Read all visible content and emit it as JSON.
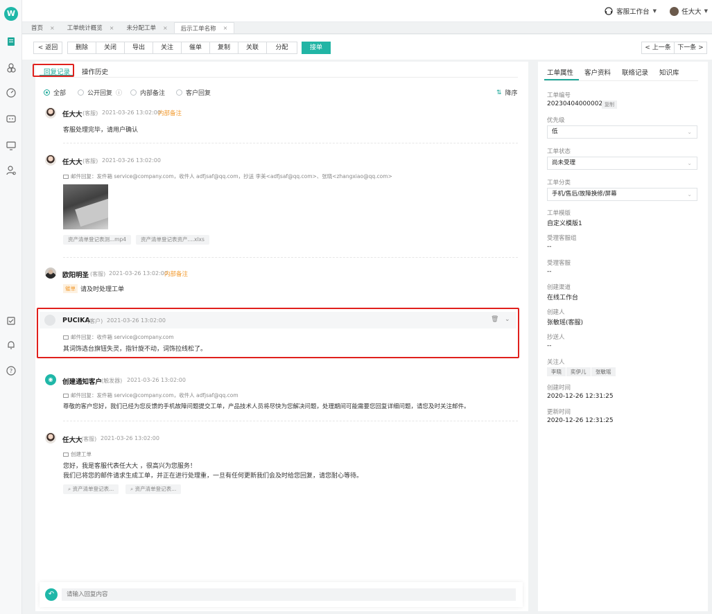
{
  "header": {
    "workspace_label": "客服工作台",
    "user_name": "任大大"
  },
  "page_tabs": [
    {
      "label": "首页"
    },
    {
      "label": "工单统计概览"
    },
    {
      "label": "未分配工单"
    },
    {
      "label": "后示工单名称"
    }
  ],
  "toolbar": {
    "back": "返回",
    "actions": [
      "删除",
      "关闭",
      "导出",
      "关注",
      "催单",
      "复制",
      "关联",
      "分配"
    ],
    "accept": "接单",
    "prev": "上一条",
    "next": "下一条"
  },
  "main_tabs": {
    "reply_records": "回复记录",
    "operation_history": "操作历史"
  },
  "filters": {
    "all": "全部",
    "public_reply": "公开回复",
    "internal_note": "内部备注",
    "customer_reply": "客户回复",
    "sort": "降序"
  },
  "records": [
    {
      "name": "任大大",
      "role": "(客服)",
      "time": "2021-03-26 13:02:00",
      "tag": "内部备注",
      "text": "客服处理完毕，请用户确认"
    },
    {
      "name": "任大大",
      "role": "(客服)",
      "time": "2021-03-26 13:02:00",
      "mail_line": "邮件回复：发件箱 service@company.com，收件人 adfjsaf@qq.com，抄送 李美<adfjsaf@qq.com>、张晓<zhangxiao@qq.com>",
      "attachments": [
        "资产清单登记表测...mp4",
        "资产清单登记表资产....xlxs"
      ]
    },
    {
      "name": "欧阳明圣",
      "role": "(客服)",
      "time": "2021-03-26 13:02:00",
      "tag": "内部备注",
      "badge": "催单",
      "text": "请及时处理工单"
    },
    {
      "name": "PUCIKA",
      "role": "(客户)",
      "time": "2021-03-26 13:02:00",
      "mail_line": "邮件回复：收件箱 service@company.com",
      "text": "其词饰选台旗钮失灵，指针旋不动，词饰拉线松了。"
    },
    {
      "name": "创建通知客户",
      "role": "(触发器)",
      "time": "2021-03-26 13:02:00",
      "mail_line": "邮件回复：发件箱 service@company.com，收件人 adfjsaf@qq.com",
      "text": "尊敬的客户您好，我们已经为您反馈的手机故障问题提交工单，产品技术人员将尽快为您解决问题，处理期间可能需要您回复详细问题，请您及时关注邮件。"
    },
    {
      "name": "任大大",
      "role": "(客服)",
      "time": "2021-03-26 13:02:00",
      "sub_label": "创建工单",
      "text_line1": "您好，我是客服代表任大大 ，很高兴为您服务！",
      "text_line2": "我们已将您的邮件请求生成工单，并正在进行处理重，一旦有任何更新我们会及时给您回复，请您耐心等待。",
      "attachments": [
        "资产清单登记表...",
        "资产清单登记表..."
      ]
    }
  ],
  "reply_placeholder": "请输入回复内容",
  "side_panel": {
    "tabs": [
      "工单属性",
      "客户资料",
      "联络记录",
      "知识库"
    ],
    "ticket_no_label": "工单编号",
    "ticket_no": "20230404000002",
    "copy": "复制",
    "priority_label": "优先级",
    "priority": "低",
    "status_label": "工单状态",
    "status": "尚未受理",
    "category_label": "工单分类",
    "category": "手机/售后/故障换修/屏幕",
    "template_label": "工单模版",
    "template": "自定义模版1",
    "group_label": "受理客服组",
    "group": "--",
    "agent_label": "受理客服",
    "agent": "--",
    "channel_label": "创建渠道",
    "channel": "在线工作台",
    "creator_label": "创建人",
    "creator": "张敏瑶(客服)",
    "cc_label": "抄送人",
    "cc": "--",
    "followers_label": "关注人",
    "followers": [
      "李晓",
      "奕伊儿",
      "张敏瑶"
    ],
    "created_label": "创建时间",
    "created": "2020-12-26 12:31:25",
    "updated_label": "更新时间",
    "updated": "2020-12-26 12:31:25"
  }
}
